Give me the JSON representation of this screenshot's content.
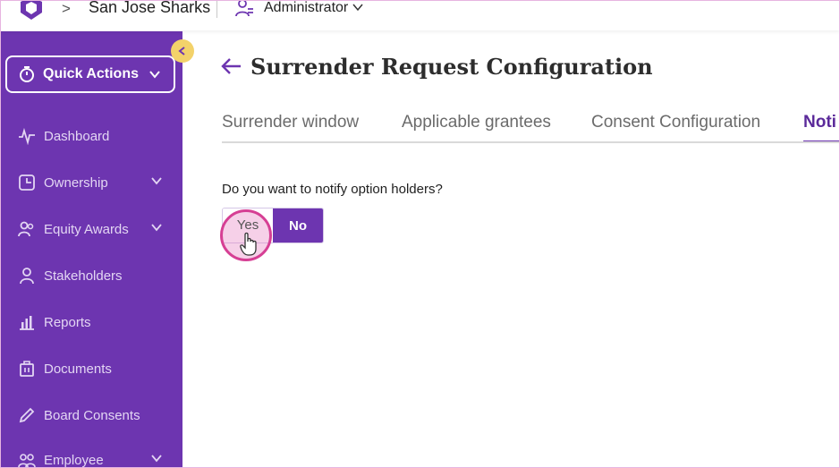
{
  "header": {
    "separator": ">",
    "org_name": "San Jose Sharks",
    "role": "Administrator"
  },
  "sidebar": {
    "quick_actions": "Quick Actions",
    "items": [
      {
        "label": "Dashboard",
        "icon": "pulse-icon",
        "has_chevron": false
      },
      {
        "label": "Ownership",
        "icon": "pie-chart-icon",
        "has_chevron": true
      },
      {
        "label": "Equity Awards",
        "icon": "users-icon",
        "has_chevron": true
      },
      {
        "label": "Stakeholders",
        "icon": "user-icon",
        "has_chevron": false
      },
      {
        "label": "Reports",
        "icon": "bar-chart-icon",
        "has_chevron": false
      },
      {
        "label": "Documents",
        "icon": "documents-icon",
        "has_chevron": false
      },
      {
        "label": "Board Consents",
        "icon": "pen-icon",
        "has_chevron": false
      },
      {
        "label": "Employee",
        "icon": "people-icon",
        "has_chevron": true
      }
    ]
  },
  "main": {
    "title": "Surrender Request Configuration",
    "tabs": [
      {
        "label": "Surrender window"
      },
      {
        "label": "Applicable grantees"
      },
      {
        "label": "Consent Configuration"
      },
      {
        "label": "Noti"
      }
    ],
    "question": "Do you want to notify option holders?",
    "toggle": {
      "yes": "Yes",
      "no": "No",
      "selected": "No"
    }
  },
  "colors": {
    "brand_purple": "#6d35b0",
    "collapse_yellow": "#f3d26a",
    "click_highlight": "#d63f94"
  }
}
